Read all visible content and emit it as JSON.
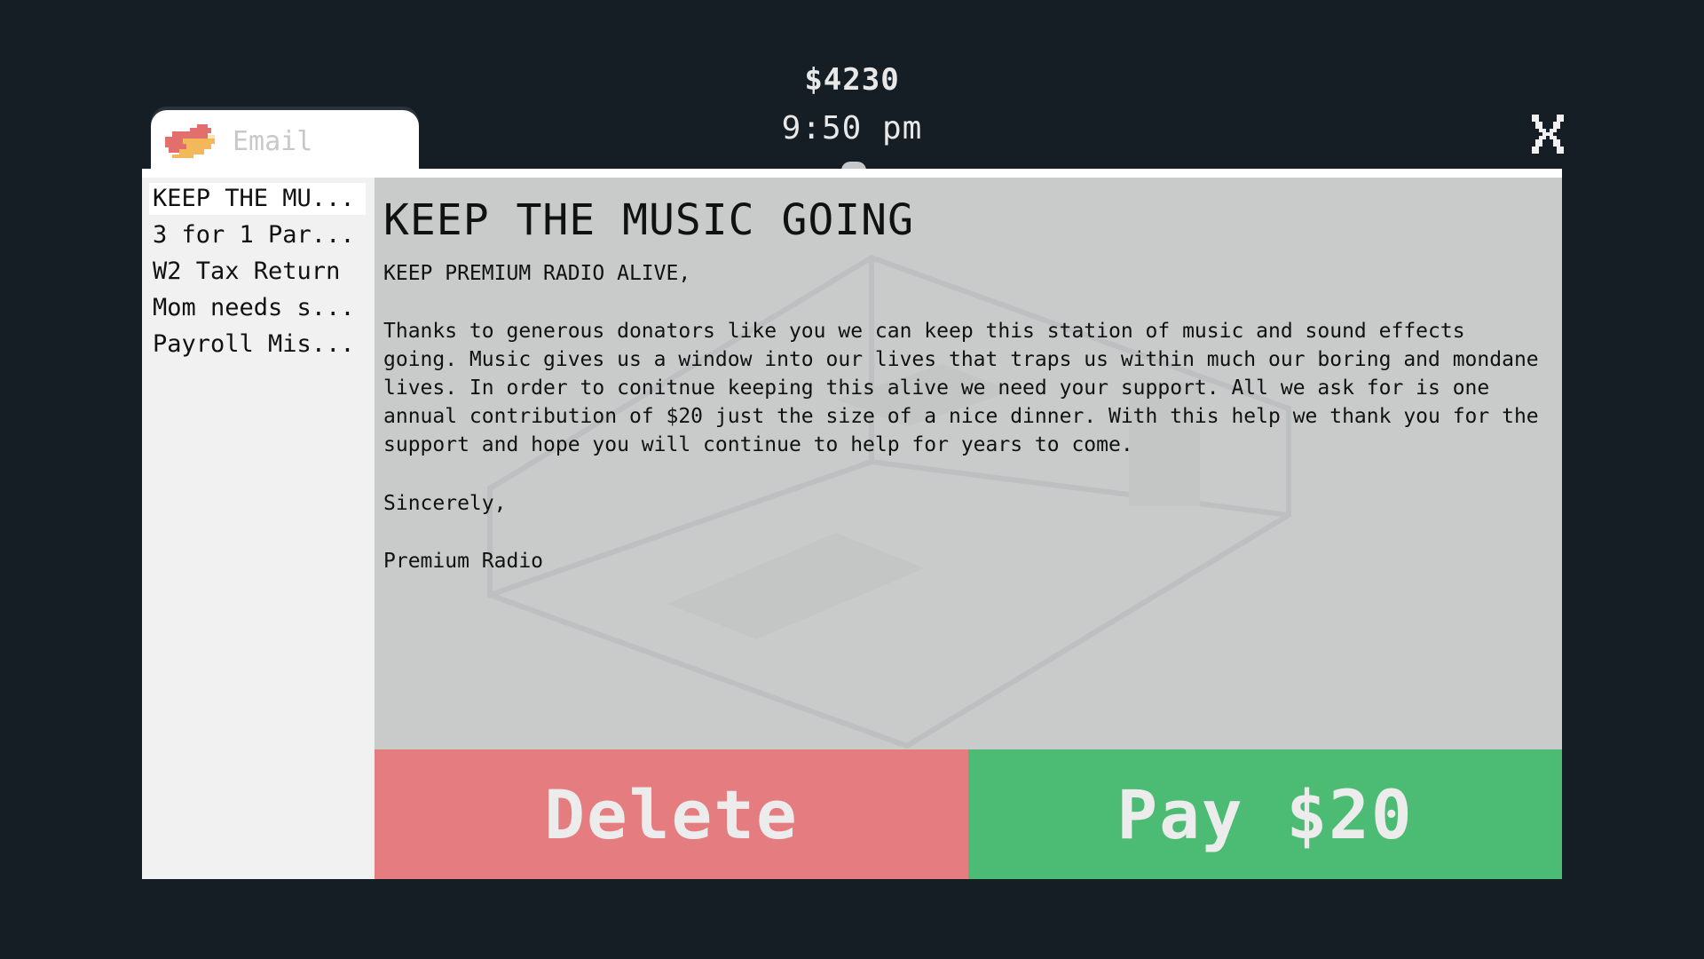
{
  "hud": {
    "money": "$4230",
    "time": "9:50 pm"
  },
  "tab": {
    "label": "Email",
    "icon": "email-bird-icon"
  },
  "sidebar": {
    "items": [
      {
        "label": "KEEP THE MU...",
        "active": true
      },
      {
        "label": "3 for 1 Par...",
        "active": false
      },
      {
        "label": "W2 Tax Return",
        "active": false
      },
      {
        "label": "Mom needs s...",
        "active": false
      },
      {
        "label": "Payroll Mis...",
        "active": false
      }
    ]
  },
  "email": {
    "title": "KEEP THE MUSIC GOING",
    "greeting": "KEEP PREMIUM RADIO ALIVE,",
    "paragraph": "Thanks to generous donators like you we can keep this station of music and sound effects going. Music gives us a window into our lives that traps us within much our boring and mondane lives. In order to conitnue keeping this alive we need your support. All we ask for is one annual contribution of $20 just the size of a nice dinner. With this help we thank you for the support and hope you will continue to help for years to come.",
    "closing": "Sincerely,",
    "signature": "Premium Radio"
  },
  "actions": {
    "delete_label": "Delete",
    "pay_label": "Pay $20"
  },
  "colors": {
    "background": "#161e25",
    "delete": "#e57c7f",
    "pay": "#4cbb73",
    "content_bg": "#c9cbcb",
    "sidebar_bg": "#f1f1f1"
  }
}
